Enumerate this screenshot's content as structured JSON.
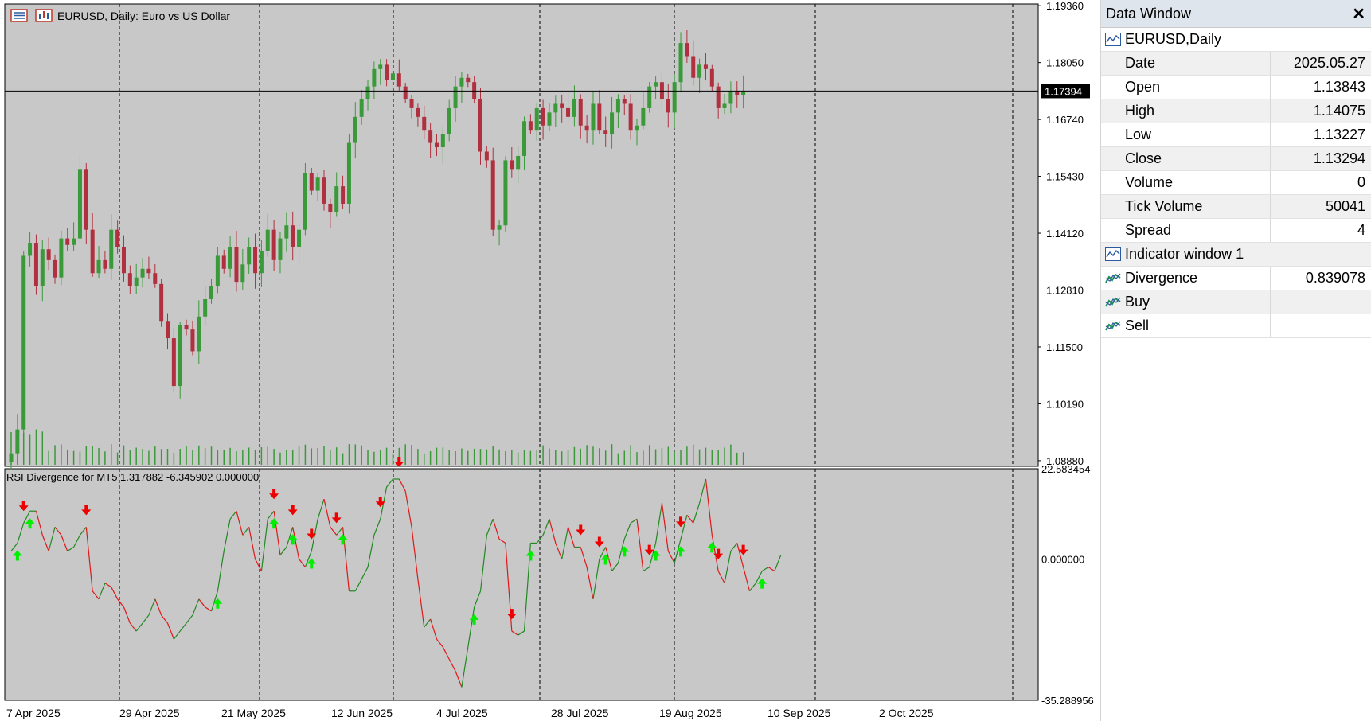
{
  "symbol": {
    "title": "EURUSD, Daily:  Euro vs US Dollar"
  },
  "indicator": {
    "label": "RSI Divergence for MT5 1.317882 -6.345902 0.000000",
    "max_label": "22.583454",
    "zero_label": "0.000000",
    "min_label": "-35.288956"
  },
  "price_axis": {
    "labels": [
      "1.19360",
      "1.18050",
      "1.16740",
      "1.15430",
      "1.14120",
      "1.12810",
      "1.11500",
      "1.10190",
      "1.08880"
    ],
    "current_price": "1.17394"
  },
  "time_axis": {
    "labels": [
      "7 Apr 2025",
      "29 Apr 2025",
      "21 May 2025",
      "12 Jun 2025",
      "4 Jul 2025",
      "28 Jul 2025",
      "19 Aug 2025",
      "10 Sep 2025",
      "2 Oct 2025"
    ]
  },
  "colors": {
    "chart_bg": "#c8c8c8",
    "bull": "#3a9a3a",
    "bear": "#b0303f",
    "rsi_up": "#228822",
    "rsi_down": "#e01818",
    "buy_arrow": "#00ee00",
    "sell_arrow": "#ee0000"
  },
  "chart_data": {
    "type": "candlestick",
    "closes": [
      1.0905,
      1.096,
      1.136,
      1.139,
      1.129,
      1.1375,
      1.135,
      1.131,
      1.14,
      1.1385,
      1.14,
      1.156,
      1.142,
      1.132,
      1.135,
      1.133,
      1.142,
      1.138,
      1.132,
      1.129,
      1.131,
      1.133,
      1.132,
      1.1295,
      1.121,
      1.117,
      1.106,
      1.12,
      1.119,
      1.114,
      1.122,
      1.126,
      1.129,
      1.136,
      1.133,
      1.138,
      1.13,
      1.134,
      1.138,
      1.132,
      1.137,
      1.142,
      1.135,
      1.14,
      1.143,
      1.138,
      1.142,
      1.155,
      1.151,
      1.154,
      1.148,
      1.146,
      1.152,
      1.148,
      1.162,
      1.168,
      1.172,
      1.175,
      1.179,
      1.18,
      1.1765,
      1.178,
      1.175,
      1.172,
      1.17,
      1.168,
      1.165,
      1.162,
      1.161,
      1.164,
      1.17,
      1.175,
      1.177,
      1.176,
      1.172,
      1.16,
      1.158,
      1.142,
      1.143,
      1.158,
      1.156,
      1.159,
      1.167,
      1.165,
      1.17,
      1.166,
      1.169,
      1.171,
      1.17,
      1.168,
      1.172,
      1.166,
      1.165,
      1.171,
      1.165,
      1.164,
      1.169,
      1.172,
      1.171,
      1.165,
      1.166,
      1.17,
      1.175,
      1.176,
      1.172,
      1.169,
      1.176,
      1.185,
      1.182,
      1.177,
      1.18,
      1.179,
      1.175,
      1.17,
      1.171,
      1.174,
      1.173,
      1.174
    ],
    "rsi_divergence": [
      2.0,
      4.0,
      9.0,
      12.0,
      12.0,
      6.0,
      2.0,
      8.0,
      6.0,
      2.0,
      3.0,
      6.0,
      8.0,
      -8.0,
      -10.0,
      -6.0,
      -7.0,
      -10.0,
      -12.0,
      -16.0,
      -18.0,
      -16.0,
      -14.0,
      -10.0,
      -14.0,
      -16.0,
      -20.0,
      -18.0,
      -16.0,
      -14.0,
      -10.0,
      -12.0,
      -13.0,
      -8.0,
      2.0,
      10.0,
      12.0,
      6.0,
      8.0,
      0.0,
      -3.0,
      10.0,
      12.0,
      1.0,
      3.0,
      8.0,
      0.0,
      -2.0,
      2.0,
      10.0,
      15.0,
      8.0,
      6.0,
      8.0,
      -8.0,
      -8.0,
      -5.0,
      -2.0,
      6.0,
      10.0,
      18.0,
      20.0,
      20.0,
      17.0,
      8.0,
      -5.0,
      -17.0,
      -15.0,
      -20.0,
      -22.0,
      -25.0,
      -28.0,
      -32.0,
      -22.0,
      -12.0,
      -8.0,
      6.0,
      10.0,
      5.0,
      4.0,
      -18.0,
      -19.0,
      -18.0,
      4.0,
      4.0,
      6.0,
      10.0,
      4.0,
      0.0,
      8.0,
      3.0,
      3.0,
      -2.0,
      -10.0,
      0.0,
      3.0,
      -3.0,
      -1.0,
      5.0,
      9.0,
      10.0,
      -3.0,
      -2.0,
      4.0,
      14.0,
      2.0,
      -1.0,
      5.0,
      11.0,
      9.0,
      14.0,
      20.0,
      6.0,
      -3.0,
      -6.0,
      2.0,
      4.0,
      -2.0,
      -8.0,
      -6.0,
      -3.0,
      -2.0,
      -3.0,
      1.0
    ],
    "buy_signal_bars": [
      1,
      3,
      33,
      42,
      45,
      48,
      53,
      74,
      83,
      95,
      98,
      103,
      107,
      112,
      120
    ],
    "sell_signal_bars": [
      2,
      12,
      42,
      45,
      48,
      52,
      59,
      62,
      80,
      91,
      94,
      102,
      107,
      113,
      117
    ],
    "ylim": [
      1.0875,
      1.194
    ],
    "indicator_ylim": [
      -35.288956,
      22.583454
    ]
  },
  "data_window": {
    "title": "Data Window",
    "symbol": "EURUSD,Daily",
    "rows": [
      {
        "label": "Date",
        "value": "2025.05.27"
      },
      {
        "label": "Open",
        "value": "1.13843"
      },
      {
        "label": "High",
        "value": "1.14075"
      },
      {
        "label": "Low",
        "value": "1.13227"
      },
      {
        "label": "Close",
        "value": "1.13294"
      },
      {
        "label": "Volume",
        "value": "0"
      },
      {
        "label": "Tick Volume",
        "value": "50041"
      },
      {
        "label": "Spread",
        "value": "4"
      }
    ],
    "indicator_group": "Indicator window 1",
    "indicator_rows": [
      {
        "label": "Divergence",
        "value": "0.839078"
      },
      {
        "label": "Buy",
        "value": ""
      },
      {
        "label": "Sell",
        "value": ""
      }
    ]
  }
}
